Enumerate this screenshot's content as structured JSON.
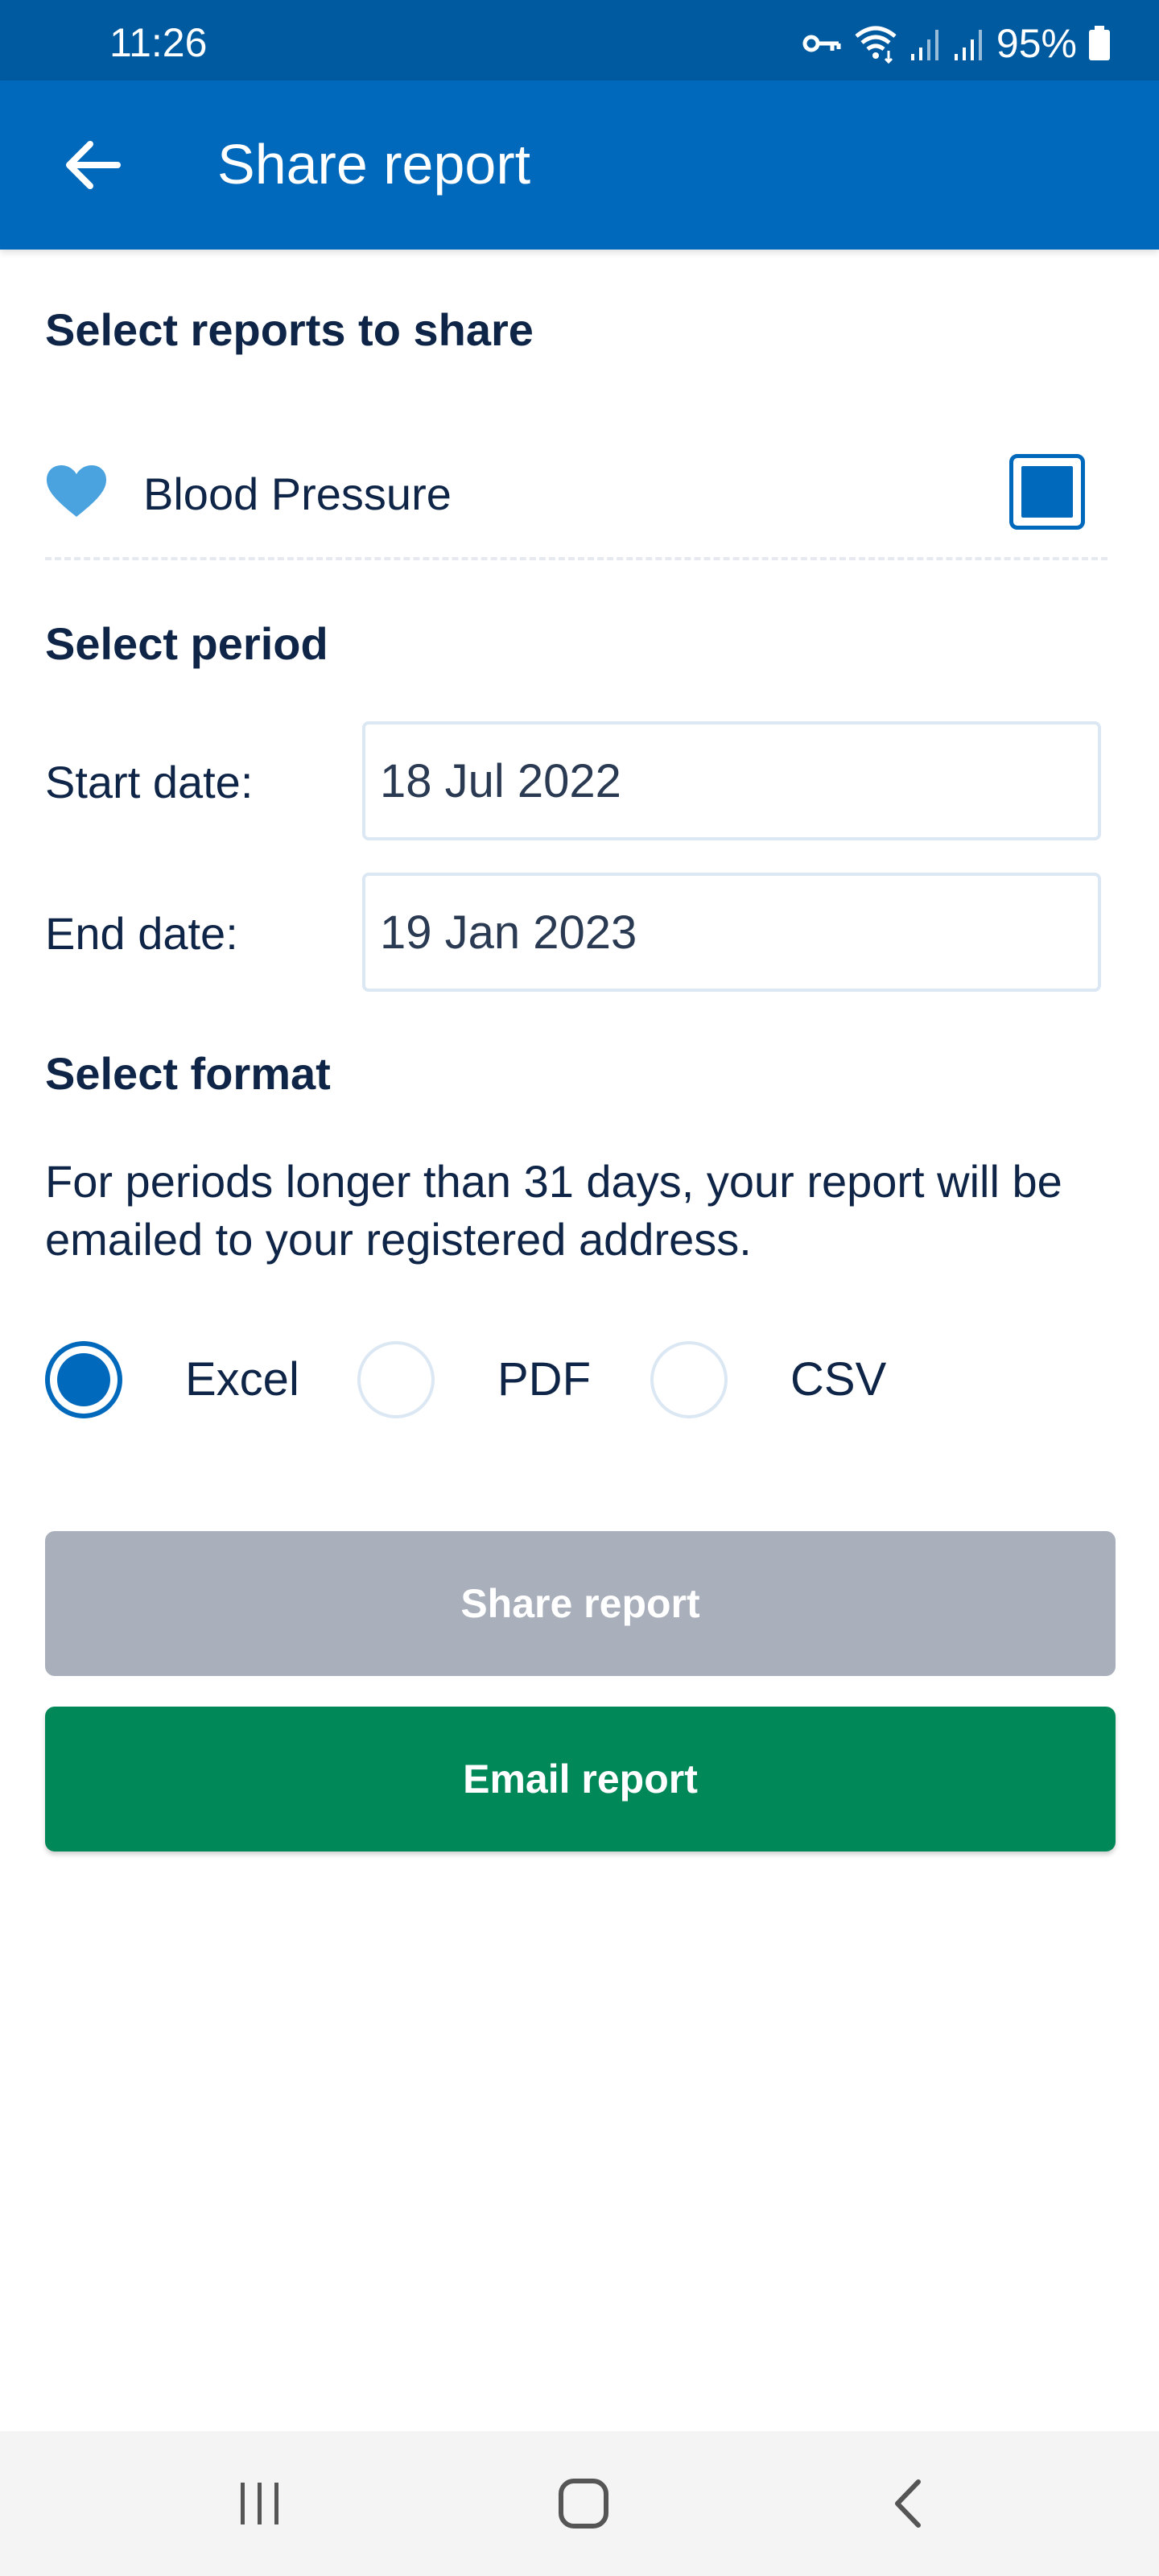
{
  "status_bar": {
    "time": "11:26",
    "battery": "95%",
    "icons": [
      "vpn-key-icon",
      "wifi-icon",
      "signal-icon",
      "signal-icon",
      "battery-icon"
    ]
  },
  "app_bar": {
    "title": "Share report",
    "back_icon": "arrow-left-icon",
    "background": "#0069bb"
  },
  "reports": {
    "heading": "Select reports to share",
    "items": [
      {
        "label": "Blood Pressure",
        "icon": "heart-icon",
        "icon_color": "#4aa3df",
        "checked": true
      }
    ]
  },
  "period": {
    "heading": "Select period",
    "start_label": "Start date:",
    "start_value": "18 Jul 2022",
    "end_label": "End date:",
    "end_value": "19 Jan 2023"
  },
  "format": {
    "heading": "Select format",
    "note": "For periods longer than 31 days, your report will be emailed to your registered address.",
    "options": [
      {
        "label": "Excel",
        "selected": true
      },
      {
        "label": "PDF",
        "selected": false
      },
      {
        "label": "CSV",
        "selected": false
      }
    ]
  },
  "actions": {
    "share_label": "Share report",
    "share_disabled": true,
    "email_label": "Email report",
    "email_color": "#008859"
  },
  "nav_bar": {
    "icons": [
      "recent-apps-icon",
      "home-icon",
      "back-icon"
    ]
  }
}
